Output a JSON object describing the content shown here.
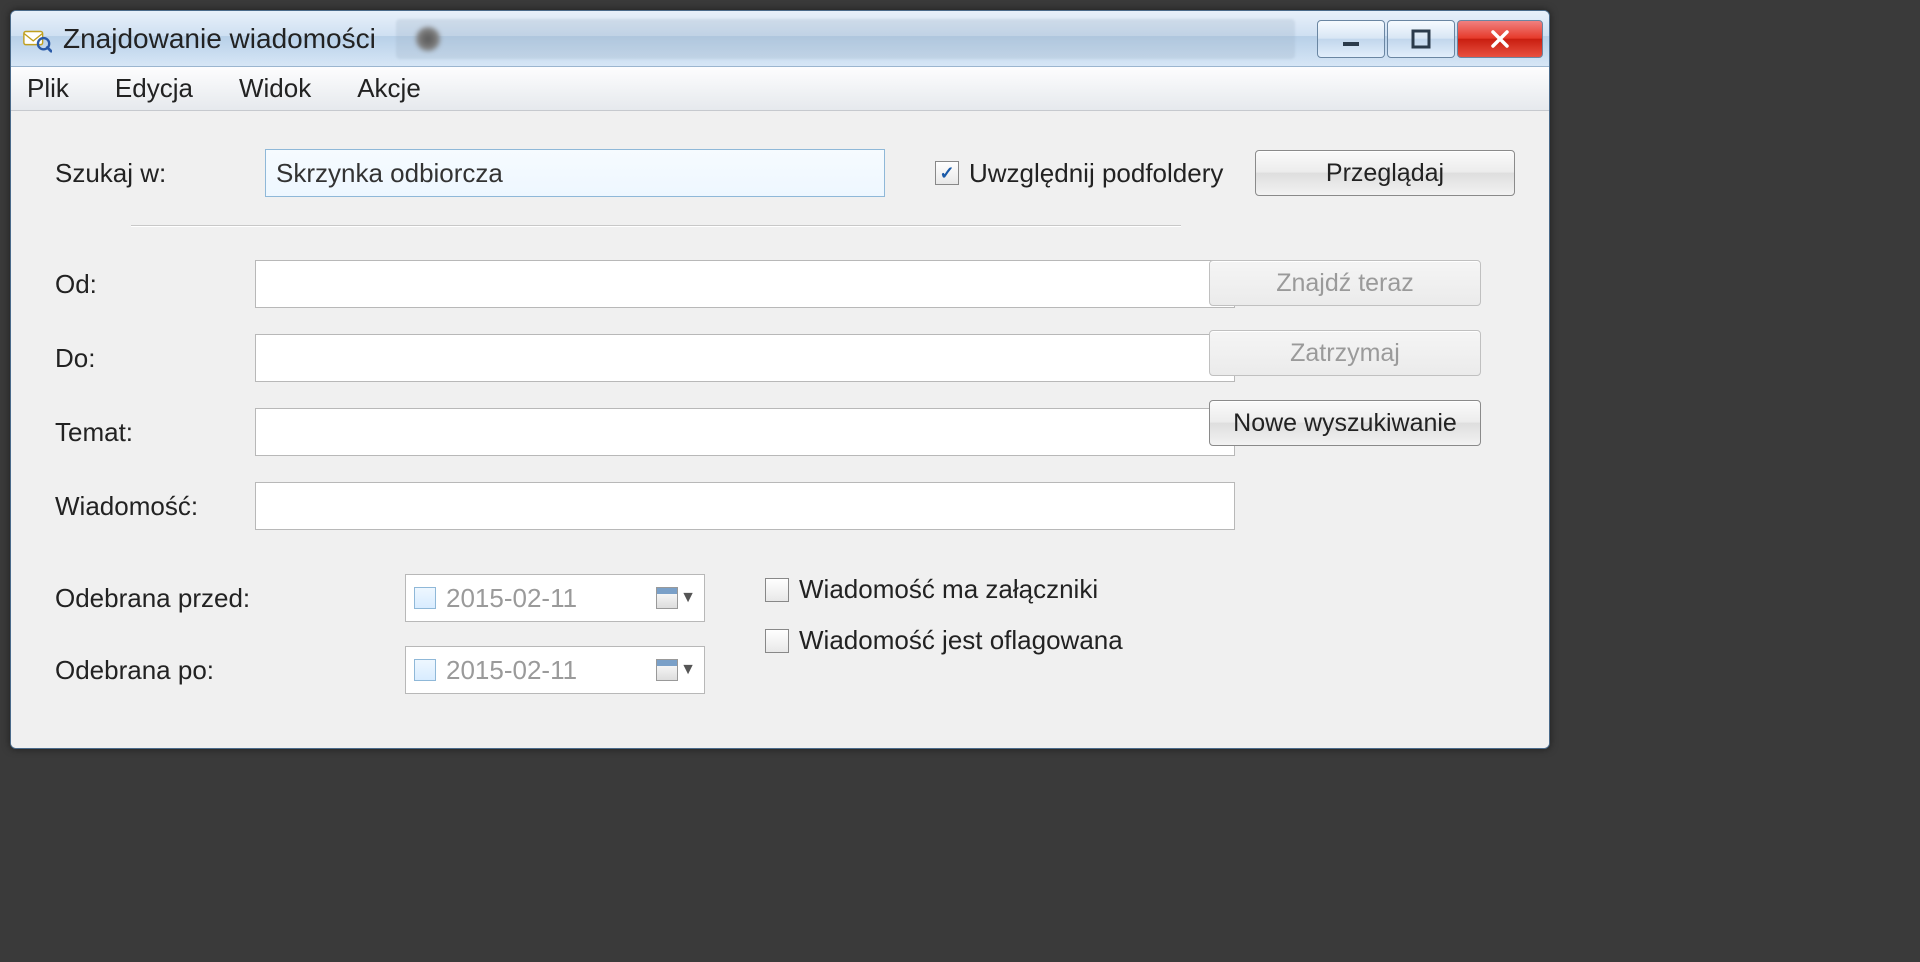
{
  "window": {
    "title": "Znajdowanie wiadomości"
  },
  "menubar": {
    "items": [
      "Plik",
      "Edycja",
      "Widok",
      "Akcje"
    ]
  },
  "form": {
    "search_in_label": "Szukaj w:",
    "search_in_value": "Skrzynka odbiorcza",
    "include_subfolders_label": "Uwzględnij podfoldery",
    "include_subfolders_checked": true,
    "browse_button": "Przeglądaj",
    "from_label": "Od:",
    "from_value": "",
    "to_label": "Do:",
    "to_value": "",
    "subject_label": "Temat:",
    "subject_value": "",
    "message_label": "Wiadomość:",
    "message_value": "",
    "received_before_label": "Odebrana przed:",
    "received_before_date": "2015-02-11",
    "received_before_checked": false,
    "received_after_label": "Odebrana po:",
    "received_after_date": "2015-02-11",
    "received_after_checked": false,
    "has_attachments_label": "Wiadomość ma załączniki",
    "has_attachments_checked": false,
    "is_flagged_label": "Wiadomość jest oflagowana",
    "is_flagged_checked": false
  },
  "buttons": {
    "find_now": "Znajdź teraz",
    "stop": "Zatrzymaj",
    "new_search": "Nowe wyszukiwanie"
  }
}
